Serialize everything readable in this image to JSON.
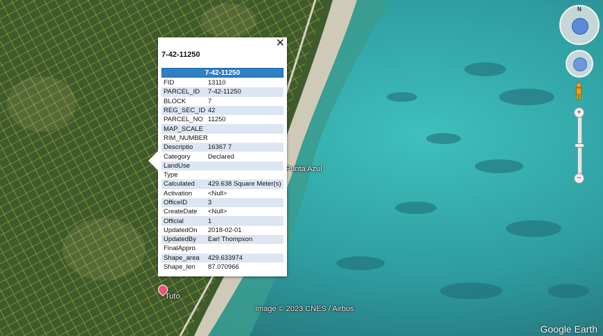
{
  "map": {
    "places": [
      "Punta Azul",
      "Tuto"
    ],
    "imagery_credit": "Image © 2023 CNES / Airbus",
    "brand": "Google Earth",
    "colors": {
      "land": "#3f5b2c",
      "shallow_water": "#42b7b4",
      "deep_water": "#2b8a8f",
      "parcel_lines": "#e8e34a",
      "beach": "#d9d4c6"
    }
  },
  "controls": {
    "north_label": "N",
    "icons": [
      "look-around-icon",
      "pan-hand-icon",
      "pegman-icon",
      "zoom-in-icon",
      "zoom-out-icon"
    ],
    "zoom_in": "+",
    "zoom_out": "−"
  },
  "popup": {
    "title": "7-42-11250",
    "header": "7-42-11250",
    "close_icon": "close-icon",
    "close_glyph": "✕",
    "attributes": [
      {
        "key": "FID",
        "value": "13110"
      },
      {
        "key": "PARCEL_ID",
        "value": "7-42-11250"
      },
      {
        "key": "BLOCK",
        "value": "7"
      },
      {
        "key": "REG_SEC_ID",
        "value": "42"
      },
      {
        "key": "PARCEL_NO",
        "value": "11250"
      },
      {
        "key": "MAP_SCALE",
        "value": ""
      },
      {
        "key": "RIM_NUMBER",
        "value": ""
      },
      {
        "key": "Descriptio",
        "value": "16367 7"
      },
      {
        "key": "Category",
        "value": "Declared"
      },
      {
        "key": "LandUse",
        "value": ""
      },
      {
        "key": "Type",
        "value": ""
      },
      {
        "key": "Calculated",
        "value": "429.638 Square Meter(s)"
      },
      {
        "key": "Activation",
        "value": "<Null>"
      },
      {
        "key": "OfficeID",
        "value": "3"
      },
      {
        "key": "CreateDate",
        "value": "<Null>"
      },
      {
        "key": "Official",
        "value": "1"
      },
      {
        "key": "UpdatedOn",
        "value": "2018-02-01"
      },
      {
        "key": "UpdatedBy",
        "value": "Earl Thompson"
      },
      {
        "key": "FinalAppro",
        "value": ""
      },
      {
        "key": "Shape_area",
        "value": "429.633974"
      },
      {
        "key": "Shape_len",
        "value": "87.070966"
      }
    ]
  }
}
